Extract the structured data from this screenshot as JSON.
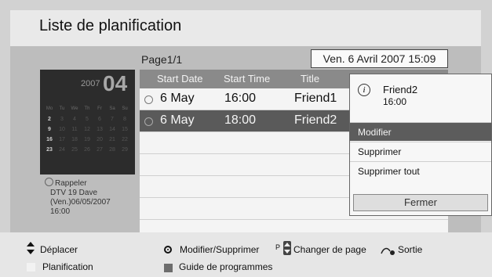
{
  "header": {
    "title": "Liste de planification"
  },
  "page": {
    "label": "Page1/1",
    "datetime": "Ven. 6 Avril 2007 15:09"
  },
  "calendar": {
    "year": "2007",
    "month": "04",
    "weekdays": [
      "Mo",
      "Tu",
      "We",
      "Th",
      "Fr",
      "Sa",
      "Su"
    ],
    "weeks": [
      [
        "2",
        "3",
        "4",
        "5",
        "6",
        "7",
        "8"
      ],
      [
        "9",
        "10",
        "11",
        "12",
        "13",
        "14",
        "15"
      ],
      [
        "16",
        "17",
        "18",
        "19",
        "20",
        "21",
        "22"
      ],
      [
        "23",
        "24",
        "25",
        "26",
        "27",
        "28",
        "29"
      ]
    ]
  },
  "reminder": {
    "line1": "Rappeler",
    "line2": "DTV 19 Dave",
    "line3": "(Ven.)06/05/2007",
    "line4": "16:00"
  },
  "table": {
    "headers": [
      "Start Date",
      "Start Time",
      "Title"
    ],
    "rows": [
      {
        "date": "6 May",
        "time": "16:00",
        "title": "Friend1"
      },
      {
        "date": "6 May",
        "time": "18:00",
        "title": "Friend2"
      }
    ]
  },
  "popup": {
    "info_icon": "i",
    "name": "Friend2",
    "time": "16:00",
    "items": [
      "Modifier",
      "Supprimer",
      "Supprimer tout"
    ],
    "close_label": "Fermer"
  },
  "footer": {
    "move": "Déplacer",
    "schedule": "Planification",
    "edit_delete": "Modifier/Supprimer",
    "p_label": "P",
    "change_page": "Changer de page",
    "exit": "Sortie",
    "guide": "Guide de programmes"
  },
  "icons": {
    "updown": "updown-arrows-icon",
    "ok": "ok-button-icon",
    "page": "page-updown-icon",
    "exit": "exit-icon"
  }
}
